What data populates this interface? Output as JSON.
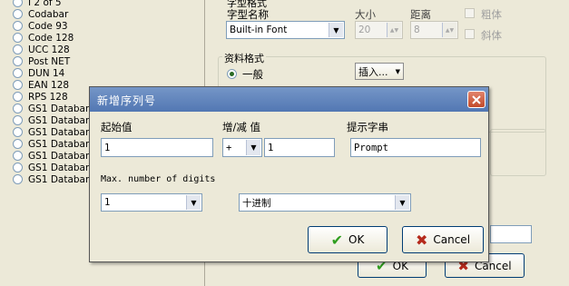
{
  "barcode_list": [
    "I 2 of 5",
    "Codabar",
    "Code 93",
    "Code 128",
    "UCC 128",
    "Post NET",
    "DUN 14",
    "EAN 128",
    "RPS 128",
    "GS1 Databar",
    "GS1 Databar",
    "GS1 Databar",
    "GS1 Databar S",
    "GS1 Databar",
    "GS1 Databar",
    "GS1 Databar"
  ],
  "font_section": {
    "title": "字型格式",
    "font_name_label": "字型名称",
    "font_name_value": "Built-in Font",
    "size_label": "大小",
    "size_value": "20",
    "spacing_label": "距离",
    "spacing_value": "8",
    "bold_label": "粗体",
    "italic_label": "斜体"
  },
  "data_format_section": {
    "title": "资料格式",
    "general_label": "一般",
    "insert_button": "插入..."
  },
  "background_buttons": {
    "ok": "OK",
    "cancel": "Cancel"
  },
  "dialog": {
    "title": "新增序列号",
    "start_label": "起始值",
    "start_value": "1",
    "increment_label": "增/减 值",
    "operator_value": "+",
    "increment_value": "1",
    "prompt_label": "提示字串",
    "prompt_value": "Prompt",
    "max_digits_label": "Max. number of digits",
    "max_digits_value": "1",
    "base_value": "十进制",
    "ok_button": "OK",
    "cancel_button": "Cancel"
  },
  "colors": {
    "titlebar": "#5b80b9",
    "close_button": "#c8553a",
    "ok_check": "#2f9e1f",
    "cancel_x": "#b52a1c"
  }
}
